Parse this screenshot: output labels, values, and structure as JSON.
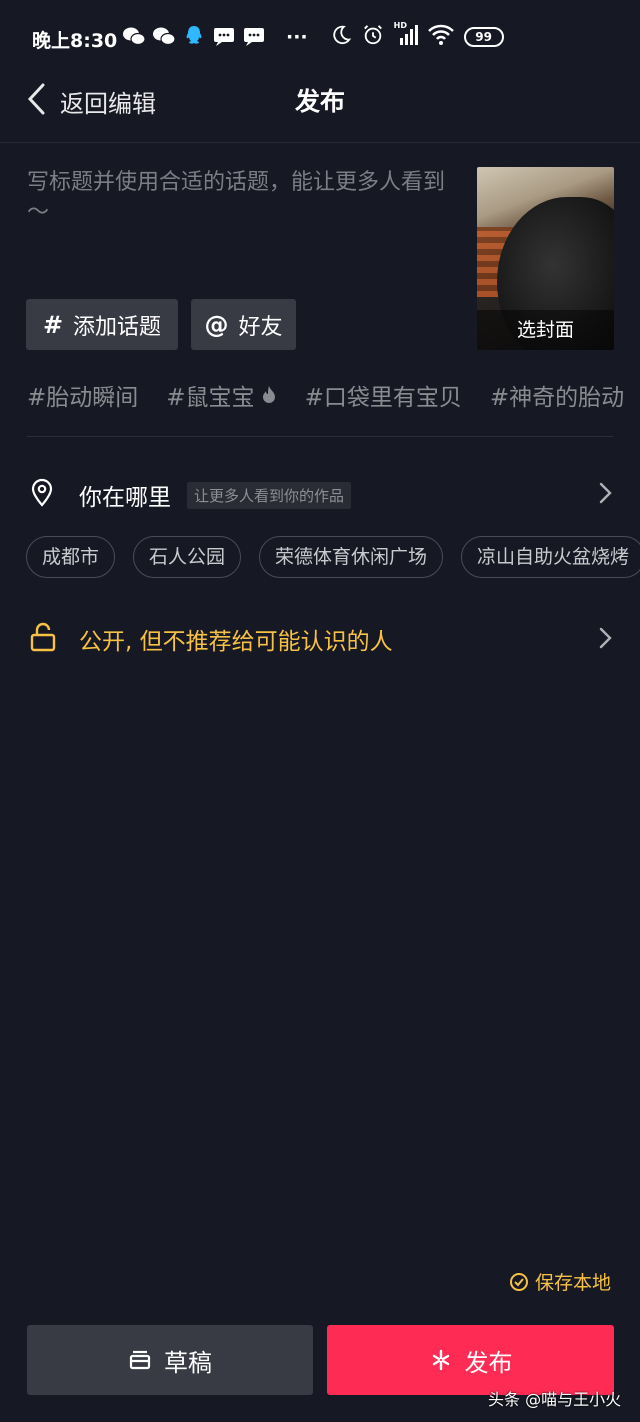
{
  "status_bar": {
    "time": "晚上8:30",
    "hd": "HD",
    "battery": "99",
    "more": "···"
  },
  "header": {
    "back_label": "返回编辑",
    "title": "发布"
  },
  "caption": {
    "placeholder": "写标题并使用合适的话题，能让更多人看到～"
  },
  "cover": {
    "label": "选封面"
  },
  "actions": {
    "add_topic": "添加话题",
    "mention_friends": "好友"
  },
  "topics": [
    "#胎动瞬间",
    "#鼠宝宝",
    "#口袋里有宝贝",
    "#神奇的胎动"
  ],
  "location": {
    "label": "你在哪里",
    "hint": "让更多人看到你的作品",
    "suggestions": [
      "成都市",
      "石人公园",
      "荣德体育休闲广场",
      "凉山自助火盆烧烤"
    ]
  },
  "privacy": {
    "label": "公开, 但不推荐给可能认识的人"
  },
  "save_local": "保存本地",
  "buttons": {
    "draft": "草稿",
    "publish": "发布"
  },
  "watermark": "头条 @喵与王小火",
  "colors": {
    "background": "#161823",
    "accent_red": "#fe2c55",
    "accent_yellow": "#f6c144"
  }
}
